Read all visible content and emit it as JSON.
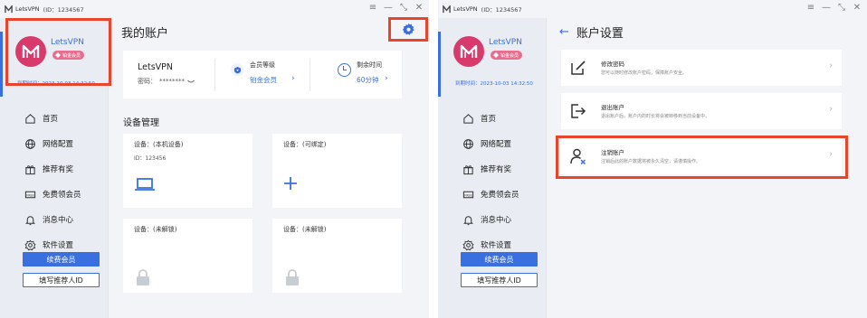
{
  "left_window": {
    "title": "LetsVPN",
    "id_text": "(ID：1234567",
    "window_controls": [
      "≡",
      "—",
      "⤡",
      "✕"
    ],
    "profile": {
      "brand": "LetsVPN",
      "badge": "铂金会员",
      "expiry": "到期时间：2023-10-03 14:32:50"
    },
    "nav": [
      {
        "label": "首页",
        "icon": "home-icon"
      },
      {
        "label": "网络配置",
        "icon": "globe-icon"
      },
      {
        "label": "推荐有奖",
        "icon": "gift-icon"
      },
      {
        "label": "免费领会员",
        "icon": "free-ticket-icon"
      },
      {
        "label": "消息中心",
        "icon": "bell-icon"
      },
      {
        "label": "软件设置",
        "icon": "settings-icon"
      }
    ],
    "renew_button": "续费会员",
    "referrer_button": "填写推荐人ID",
    "page_title": "我的账户",
    "account": {
      "name": "LetsVPN",
      "password_label": "密码：",
      "password_mask": "********",
      "level_label": "会员等级",
      "level_value": "铂金会员",
      "time_label": "剩余时间",
      "time_value": "60分钟",
      "chevron": "›"
    },
    "devices_title": "设备管理",
    "devices": [
      {
        "label": "设备：(本机设备)",
        "id": "ID：123456",
        "state": "laptop"
      },
      {
        "label": "设备：(可绑定)",
        "state": "add"
      },
      {
        "label": "设备：(未解锁)",
        "state": "locked"
      },
      {
        "label": "设备：(未解锁)",
        "state": "locked"
      }
    ],
    "accent_color": "#3a6fe0",
    "highlight_color": "#e8452c"
  },
  "right_window": {
    "title": "LetsVPN",
    "id_text": "(ID：1234567",
    "window_controls": [
      "≡",
      "—",
      "⤡",
      "✕"
    ],
    "profile": {
      "brand": "LetsVPN",
      "badge": "铂金会员",
      "expiry": "到期时间：2023-10-03 14:32:50"
    },
    "nav": [
      {
        "label": "首页"
      },
      {
        "label": "网络配置"
      },
      {
        "label": "推荐有奖"
      },
      {
        "label": "免费领会员"
      },
      {
        "label": "消息中心"
      },
      {
        "label": "软件设置"
      }
    ],
    "renew_button": "续费会员",
    "referrer_button": "填写推荐人ID",
    "page_title": "账户设置",
    "back_icon": "←",
    "rows": [
      {
        "title": "修改密码",
        "desc": "您可以随时修改账户密码，保障账户安全。",
        "icon": "edit-icon"
      },
      {
        "title": "退出账户",
        "desc": "退出账户后，账户内的时长将会被转移到当前设备中。",
        "icon": "logout-icon"
      },
      {
        "title": "注销账户",
        "desc": "注销后此的账户数据将被永久清空，请谨慎操作。",
        "icon": "delete-user-icon"
      }
    ],
    "chevron": "›"
  }
}
